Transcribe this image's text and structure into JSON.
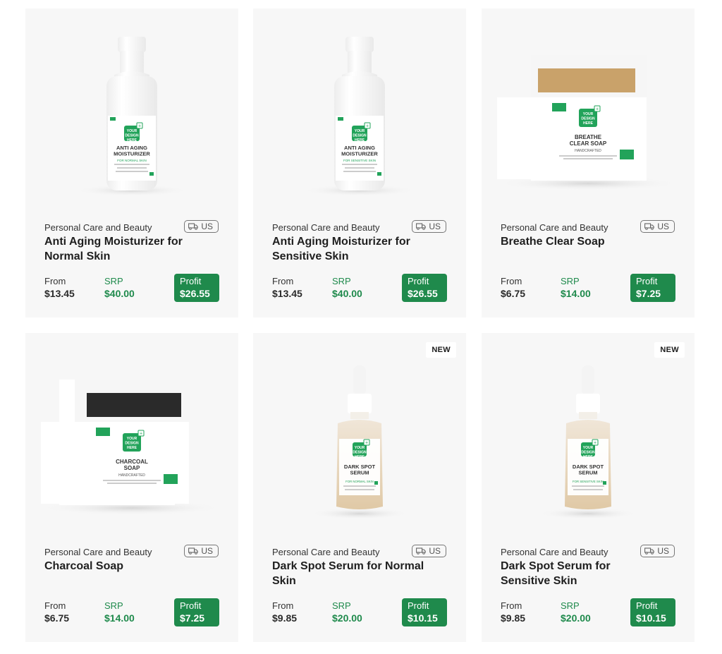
{
  "colors": {
    "card_bg": "#f7f7f7",
    "accent_green": "#1f8a4c",
    "label_green": "#2aa05c"
  },
  "products": [
    {
      "category": "Personal Care and Beauty",
      "origin": "US",
      "name": "Anti Aging Moisturizer for Normal Skin",
      "from_label": "From",
      "from_value": "$13.45",
      "srp_label": "SRP",
      "srp_value": "$40.00",
      "profit_label": "Profit",
      "profit_value": "$26.55",
      "image": {
        "kind": "spray-bottle",
        "label_title": "ANTI AGING MOISTURIZER",
        "label_sub": "FOR NORMAL SKIN",
        "design_text": "YOUR DESIGN HERE"
      },
      "badge": ""
    },
    {
      "category": "Personal Care and Beauty",
      "origin": "US",
      "name": "Anti Aging Moisturizer for Sensitive Skin",
      "from_label": "From",
      "from_value": "$13.45",
      "srp_label": "SRP",
      "srp_value": "$40.00",
      "profit_label": "Profit",
      "profit_value": "$26.55",
      "image": {
        "kind": "spray-bottle",
        "label_title": "ANTI AGING MOISTURIZER",
        "label_sub": "FOR SENSITIVE SKIN",
        "design_text": "YOUR DESIGN HERE"
      },
      "badge": ""
    },
    {
      "category": "Personal Care and Beauty",
      "origin": "US",
      "name": "Breathe Clear Soap",
      "from_label": "From",
      "from_value": "$6.75",
      "srp_label": "SRP",
      "srp_value": "$14.00",
      "profit_label": "Profit",
      "profit_value": "$7.25",
      "image": {
        "kind": "soap-light",
        "label_title": "BREATHE CLEAR SOAP",
        "label_sub": "HANDCRAFTED",
        "design_text": "YOUR DESIGN HERE"
      },
      "badge": ""
    },
    {
      "category": "Personal Care and Beauty",
      "origin": "US",
      "name": "Charcoal Soap",
      "from_label": "From",
      "from_value": "$6.75",
      "srp_label": "SRP",
      "srp_value": "$14.00",
      "profit_label": "Profit",
      "profit_value": "$7.25",
      "image": {
        "kind": "soap-dark",
        "label_title": "CHARCOAL SOAP",
        "label_sub": "HANDCRAFTED",
        "design_text": "YOUR DESIGN HERE"
      },
      "badge": ""
    },
    {
      "category": "Personal Care and Beauty",
      "origin": "US",
      "name": "Dark Spot Serum for Normal Skin",
      "from_label": "From",
      "from_value": "$9.85",
      "srp_label": "SRP",
      "srp_value": "$20.00",
      "profit_label": "Profit",
      "profit_value": "$10.15",
      "image": {
        "kind": "dropper",
        "label_title": "DARK SPOT SERUM",
        "label_sub": "FOR NORMAL SKIN",
        "design_text": "YOUR DESIGN HERE"
      },
      "badge": "NEW"
    },
    {
      "category": "Personal Care and Beauty",
      "origin": "US",
      "name": "Dark Spot Serum for Sensitive Skin",
      "from_label": "From",
      "from_value": "$9.85",
      "srp_label": "SRP",
      "srp_value": "$20.00",
      "profit_label": "Profit",
      "profit_value": "$10.15",
      "image": {
        "kind": "dropper",
        "label_title": "DARK SPOT SERUM",
        "label_sub": "FOR SENSITIVE SKIN",
        "design_text": "YOUR DESIGN HERE"
      },
      "badge": "NEW"
    }
  ]
}
